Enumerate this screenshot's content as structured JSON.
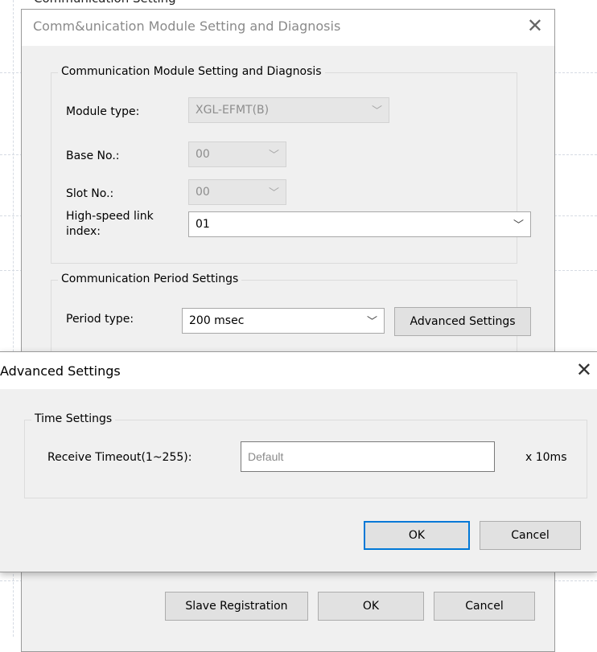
{
  "top_caption": "Communication Setting",
  "dialog": {
    "title": "Comm&unication Module Setting and Diagnosis",
    "group_module": {
      "caption": "Communication Module Setting and Diagnosis",
      "module_type_label": "Module type:",
      "module_type_value": "XGL-EFMT(B)",
      "base_no_label": "Base No.:",
      "base_no_value": "00",
      "slot_no_label": "Slot No.:",
      "slot_no_value": "00",
      "hs_link_label_line1": "High-speed link",
      "hs_link_label_line2": "index:",
      "hs_link_value": "01"
    },
    "group_period": {
      "caption": "Communication Period Settings",
      "period_type_label": "Period type:",
      "period_type_value": "200 msec",
      "advanced_button": "Advanced Settings"
    },
    "buttons": {
      "slave_registration": "Slave Registration",
      "ok": "OK",
      "cancel": "Cancel"
    }
  },
  "advanced_dialog": {
    "title": "Advanced Settings",
    "group_caption": "Time Settings",
    "receive_timeout_label": "Receive Timeout(1~255):",
    "receive_timeout_placeholder": "Default",
    "unit": "x 10ms",
    "ok": "OK",
    "cancel": "Cancel"
  },
  "icons": {
    "close": "close-icon",
    "chevron": "chevron-down-icon"
  }
}
